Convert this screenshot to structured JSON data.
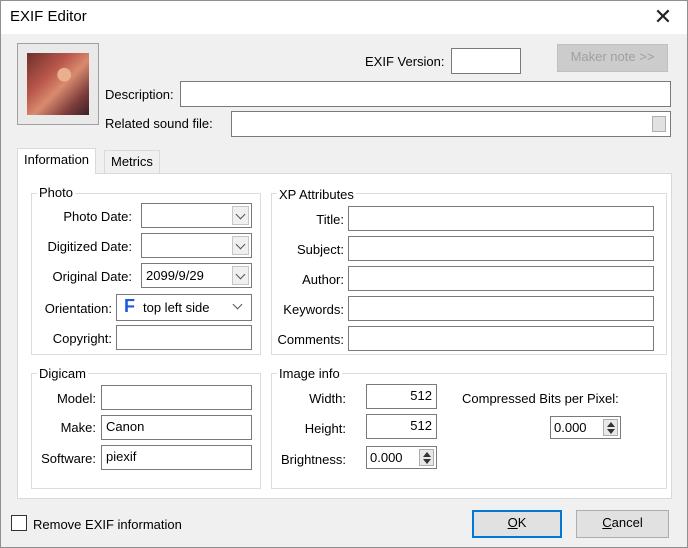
{
  "window": {
    "title": "EXIF Editor"
  },
  "header": {
    "exif_version_label": "EXIF Version:",
    "exif_version_value": "",
    "maker_note_button": "Maker note >>",
    "description_label": "Description:",
    "description_value": "",
    "sound_label": "Related sound file:",
    "sound_value": ""
  },
  "tabs": [
    {
      "label": "Information",
      "active": true
    },
    {
      "label": "Metrics",
      "active": false
    }
  ],
  "photo": {
    "title": "Photo",
    "photo_date_label": "Photo Date:",
    "photo_date_value": "",
    "digitized_date_label": "Digitized Date:",
    "digitized_date_value": "",
    "original_date_label": "Original Date:",
    "original_date_value": "2099/9/29",
    "orientation_label": "Orientation:",
    "orientation_glyph": "F",
    "orientation_value": "top left side",
    "copyright_label": "Copyright:",
    "copyright_value": ""
  },
  "xp": {
    "title": "XP Attributes",
    "title_label": "Title:",
    "title_value": "",
    "subject_label": "Subject:",
    "subject_value": "",
    "author_label": "Author:",
    "author_value": "",
    "keywords_label": "Keywords:",
    "keywords_value": "",
    "comments_label": "Comments:",
    "comments_value": ""
  },
  "digicam": {
    "title": "Digicam",
    "model_label": "Model:",
    "model_value": "",
    "make_label": "Make:",
    "make_value": "Canon",
    "software_label": "Software:",
    "software_value": "piexif"
  },
  "image_info": {
    "title": "Image info",
    "width_label": "Width:",
    "width_value": "512",
    "height_label": "Height:",
    "height_value": "512",
    "brightness_label": "Brightness:",
    "brightness_value": "0.000",
    "cbpp_label": "Compressed Bits per Pixel:",
    "cbpp_value": "0.000"
  },
  "footer": {
    "remove_exif_label": "Remove EXIF information",
    "remove_exif_checked": false,
    "ok_letter": "O",
    "ok_rest": "K",
    "cancel_letter": "C",
    "cancel_rest": "ancel"
  },
  "colors": {
    "accent": "#0078d7",
    "orientation_glyph": "#1e5bd8"
  },
  "icons": {
    "close": "close-icon",
    "thumbnail": "photo-thumbnail",
    "dropdown": "chevron-down-icon",
    "spin": "spin-arrows-icon"
  }
}
